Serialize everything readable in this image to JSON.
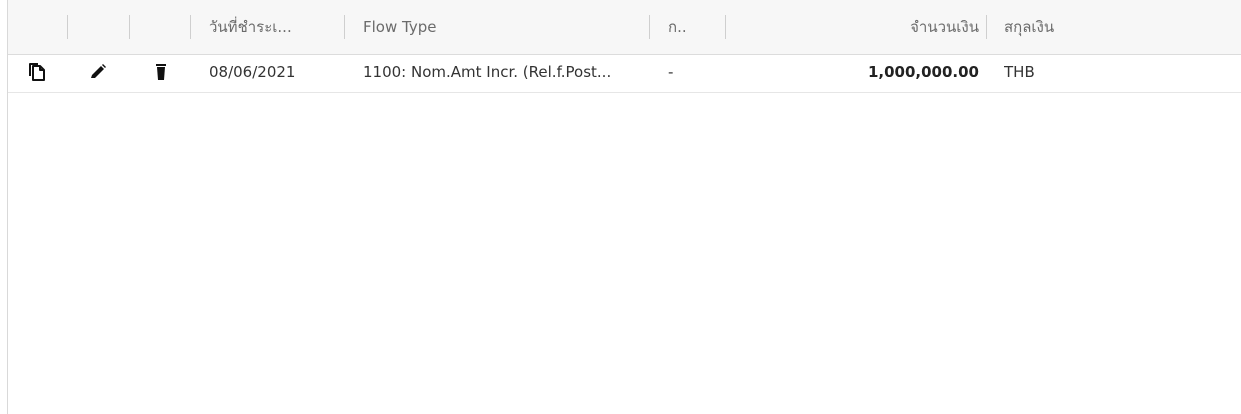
{
  "table": {
    "columns": [
      {
        "key": "copy",
        "label": ""
      },
      {
        "key": "edit",
        "label": ""
      },
      {
        "key": "delete",
        "label": ""
      },
      {
        "key": "due_date",
        "label": "วันที่ชำระเ..."
      },
      {
        "key": "flow_type",
        "label": "Flow Type"
      },
      {
        "key": "short_col",
        "label": "ก.."
      },
      {
        "key": "blank_col",
        "label": ""
      },
      {
        "key": "amount",
        "label": "จำนวนเงิน"
      },
      {
        "key": "currency",
        "label": "สกุลเงิน"
      }
    ],
    "rows": [
      {
        "copy_icon": "copy-icon",
        "edit_icon": "pencil-icon",
        "delete_icon": "trash-icon",
        "due_date": "08/06/2021",
        "flow_type": "1100: Nom.Amt Incr. (Rel.f.Post...",
        "short_col": "-",
        "amount": "1,000,000.00",
        "currency": "THB"
      }
    ]
  }
}
